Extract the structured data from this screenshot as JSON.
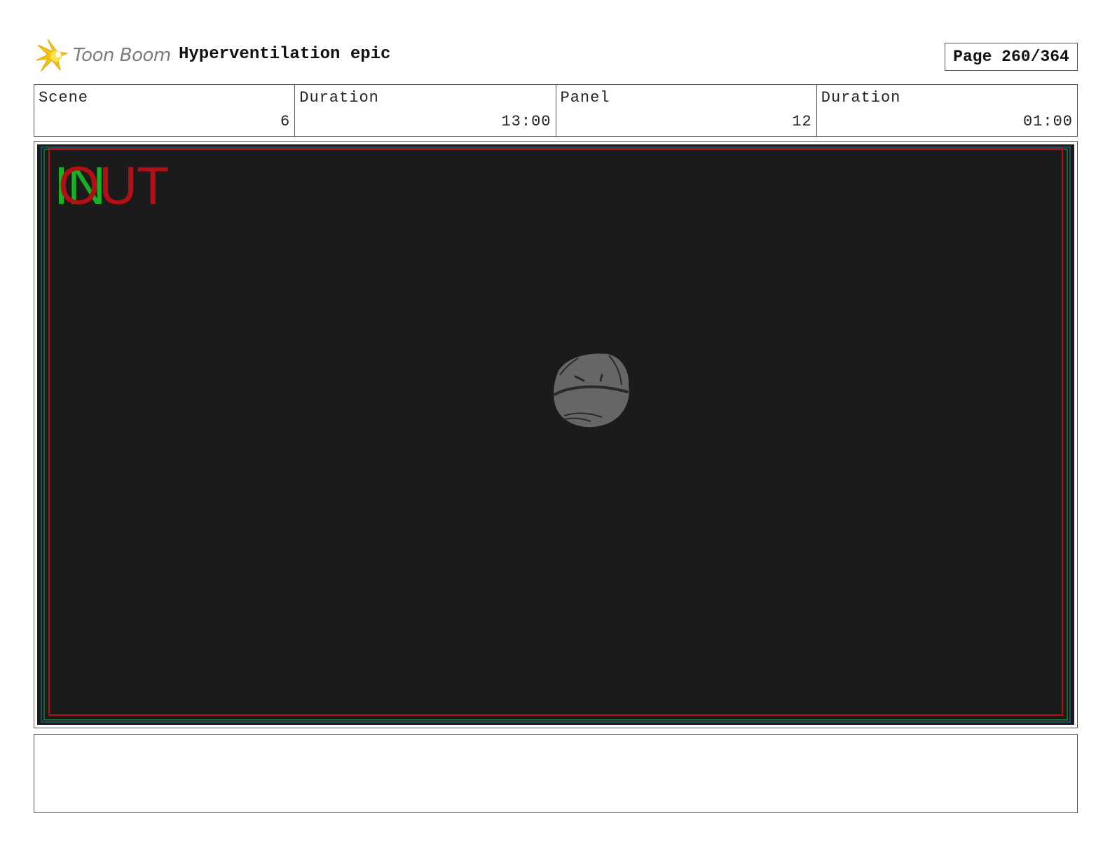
{
  "header": {
    "logo_text": "Toon Boom",
    "project_title": "Hyperventilation epic",
    "page_label": "Page 260/364"
  },
  "info": {
    "scene_label": "Scene",
    "scene_value": "6",
    "scene_duration_label": "Duration",
    "scene_duration_value": "13:00",
    "panel_label": "Panel",
    "panel_value": "12",
    "panel_duration_label": "Duration",
    "panel_duration_value": "01:00"
  },
  "panel": {
    "in_marker": "IN",
    "out_marker": "OUT",
    "background_color": "#1b1b1b",
    "in_color": "#19b024",
    "out_color": "#b30f15"
  },
  "notes": {
    "text": ""
  },
  "icons": {
    "logo": "toon-boom-star-logo"
  }
}
